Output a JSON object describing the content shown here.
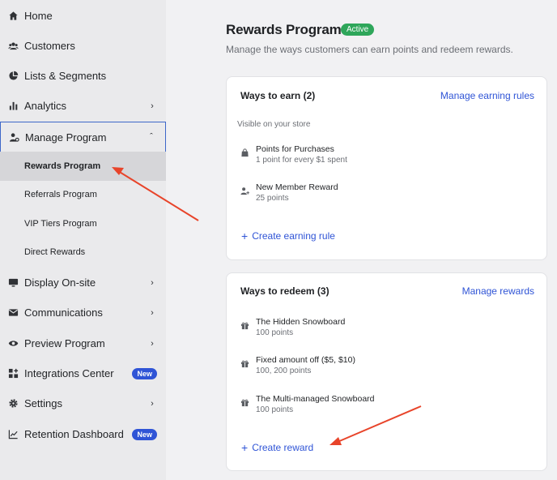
{
  "sidebar": {
    "items": [
      {
        "label": "Home",
        "icon": "home-icon"
      },
      {
        "label": "Customers",
        "icon": "customers-icon"
      },
      {
        "label": "Lists & Segments",
        "icon": "pie-chart-icon"
      },
      {
        "label": "Analytics",
        "icon": "bar-chart-icon"
      },
      {
        "label": "Manage Program",
        "icon": "user-settings-icon"
      },
      {
        "label": "Display On-site",
        "icon": "monitor-icon"
      },
      {
        "label": "Communications",
        "icon": "mail-icon"
      },
      {
        "label": "Preview Program",
        "icon": "eye-icon"
      },
      {
        "label": "Integrations Center",
        "icon": "grid-plus-icon",
        "badge": "New"
      },
      {
        "label": "Settings",
        "icon": "gear-icon"
      },
      {
        "label": "Retention Dashboard",
        "icon": "trend-line-icon",
        "badge": "New"
      }
    ],
    "subitems": [
      {
        "label": "Rewards Program",
        "active": true
      },
      {
        "label": "Referrals Program"
      },
      {
        "label": "VIP Tiers Program"
      },
      {
        "label": "Direct Rewards"
      }
    ]
  },
  "main": {
    "title": "Rewards Program",
    "status": "Active",
    "subtitle": "Manage the ways customers can earn points and redeem rewards.",
    "earn_card": {
      "title": "Ways to earn (2)",
      "link": "Manage earning rules",
      "section_label": "Visible on your store",
      "rows": [
        {
          "title": "Points for Purchases",
          "detail": "1 point for every $1 spent",
          "icon": "shopping-bag-icon"
        },
        {
          "title": "New Member Reward",
          "detail": "25 points",
          "icon": "user-plus-icon"
        }
      ],
      "create_label": "Create earning rule"
    },
    "redeem_card": {
      "title": "Ways to redeem (3)",
      "link": "Manage rewards",
      "rows": [
        {
          "title": "The Hidden Snowboard",
          "detail": "100 points",
          "icon": "gift-icon"
        },
        {
          "title": "Fixed amount off ($5, $10)",
          "detail": "100, 200 points",
          "icon": "gift-icon"
        },
        {
          "title": "The Multi-managed Snowboard",
          "detail": "100 points",
          "icon": "gift-icon"
        }
      ],
      "create_label": "Create reward"
    }
  },
  "colors": {
    "accent": "#2f54d6",
    "active_badge": "#2ea65a",
    "annotation_arrow": "#e8442a"
  }
}
